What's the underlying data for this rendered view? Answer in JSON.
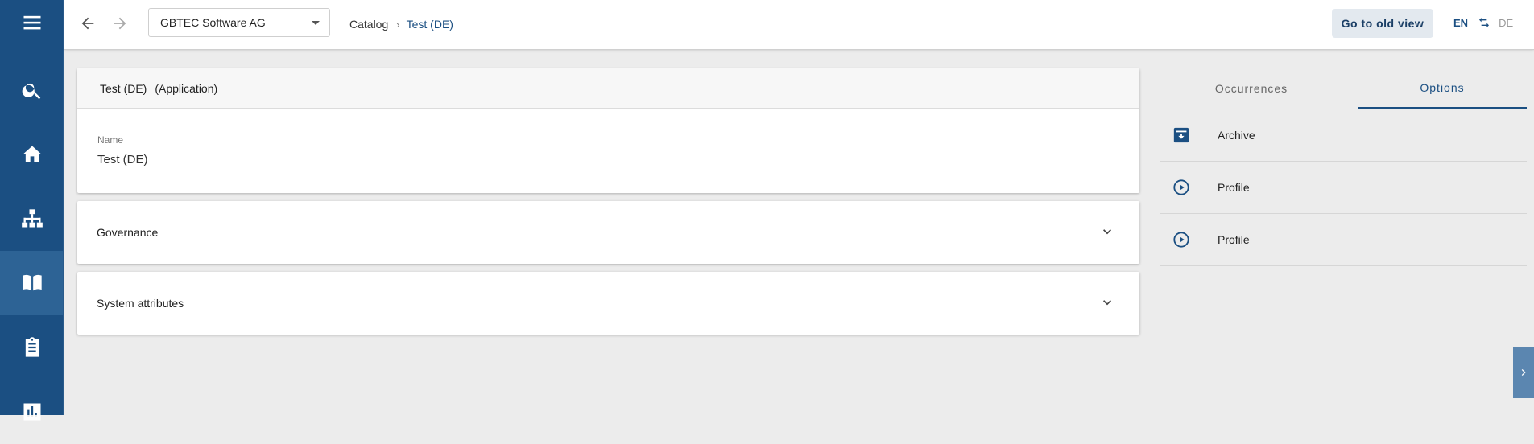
{
  "topbar": {
    "tenant": "GBTEC Software AG",
    "breadcrumb": [
      "Catalog",
      "Test (DE)"
    ],
    "old_view_label": "Go to old view",
    "lang_current": "EN",
    "lang_other": "DE"
  },
  "object": {
    "title": "Test (DE)",
    "type": "(Application)",
    "name_label": "Name",
    "name_value": "Test (DE)"
  },
  "sections": {
    "governance": "Governance",
    "system_attributes": "System attributes"
  },
  "right_panel": {
    "tabs": [
      "Occurrences",
      "Options"
    ],
    "options": [
      {
        "label": "Archive",
        "icon": "archive-icon"
      },
      {
        "label": "Profile",
        "icon": "play-circle-icon"
      },
      {
        "label": "Profile",
        "icon": "play-circle-icon"
      }
    ]
  },
  "sidebar": {
    "icons": [
      "menu-icon",
      "search-icon",
      "home-icon",
      "hierarchy-icon",
      "catalog-book-icon",
      "clipboard-icon",
      "chart-icon"
    ]
  },
  "colors": {
    "primary": "#1b4f82",
    "sidebar_active": "#2d6395",
    "background": "#ececec"
  }
}
